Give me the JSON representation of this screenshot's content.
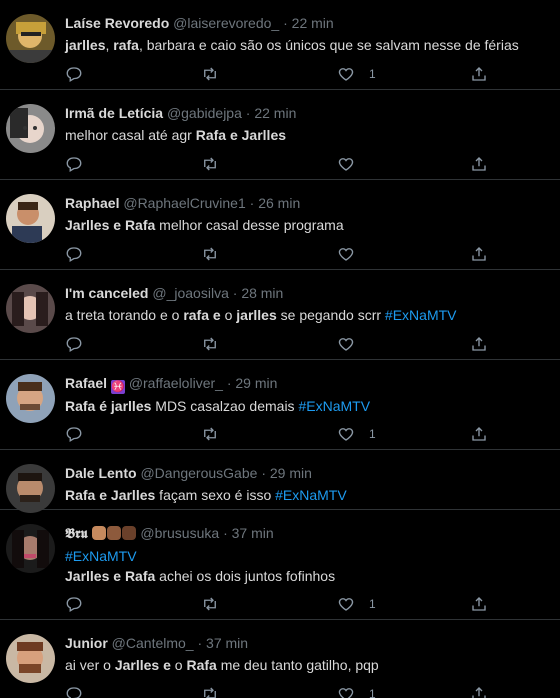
{
  "tweets": [
    {
      "name": "Laíse Revoredo",
      "handle": "@laiserevoredo_",
      "time": "22 min",
      "segments": [
        {
          "t": "b",
          "v": "jarlles"
        },
        {
          "t": "n",
          "v": ", "
        },
        {
          "t": "b",
          "v": "rafa"
        },
        {
          "t": "n",
          "v": ", barbara e caio são os únicos que se salvam nesse de férias"
        }
      ],
      "likes": "1"
    },
    {
      "name": "Irmã de Letícia",
      "handle": "@gabidejpa",
      "time": "22 min",
      "segments": [
        {
          "t": "n",
          "v": "melhor casal até agr "
        },
        {
          "t": "b",
          "v": "Rafa e Jarlles"
        }
      ],
      "likes": ""
    },
    {
      "name": "Raphael",
      "handle": "@RaphaelCruvine1",
      "time": "26 min",
      "segments": [
        {
          "t": "b",
          "v": "Jarlles e Rafa"
        },
        {
          "t": "n",
          "v": " melhor casal desse programa"
        }
      ],
      "likes": ""
    },
    {
      "name": "I'm canceled",
      "handle": "@_joaosilva",
      "time": "28 min",
      "segments": [
        {
          "t": "n",
          "v": "a treta torando e o "
        },
        {
          "t": "b",
          "v": "rafa"
        },
        {
          "t": "n",
          "v": " "
        },
        {
          "t": "b",
          "v": "e"
        },
        {
          "t": "n",
          "v": " o "
        },
        {
          "t": "b",
          "v": "jarlles"
        },
        {
          "t": "n",
          "v": " se pegando scrr "
        },
        {
          "t": "h",
          "v": "#ExNaMTV"
        }
      ],
      "likes": ""
    },
    {
      "name": "Rafael",
      "name_emoji": "♓",
      "handle": "@raffaeloliver_",
      "time": "29 min",
      "segments": [
        {
          "t": "b",
          "v": "Rafa é jarlles"
        },
        {
          "t": "n",
          "v": " MDS casalzao demais "
        },
        {
          "t": "h",
          "v": "#ExNaMTV"
        }
      ],
      "likes": "1"
    },
    {
      "name": "Dale Lento",
      "handle": "@DangerousGabe",
      "time": "29 min",
      "segments": [
        {
          "t": "b",
          "v": "Rafa e Jarlles"
        },
        {
          "t": "n",
          "v": " façam sexo é isso "
        },
        {
          "t": "h",
          "v": "#ExNaMTV"
        }
      ],
      "likes": ""
    },
    {
      "name": "𝕭𝖗𝖚",
      "handle": "@brususuka",
      "time": "37 min",
      "segments": [
        {
          "t": "h",
          "v": "#ExNaMTV"
        },
        {
          "t": "br",
          "v": ""
        },
        {
          "t": "b",
          "v": "Jarlles e Rafa"
        },
        {
          "t": "n",
          "v": " achei os dois juntos fofinhos"
        }
      ],
      "likes": "1"
    },
    {
      "name": "Junior",
      "handle": "@Cantelmo_",
      "time": "37 min",
      "segments": [
        {
          "t": "n",
          "v": "ai ver o "
        },
        {
          "t": "b",
          "v": "Jarlles e"
        },
        {
          "t": "n",
          "v": " o "
        },
        {
          "t": "b",
          "v": "Rafa"
        },
        {
          "t": "n",
          "v": " me deu tanto gatilho, pqp"
        }
      ],
      "likes": "1"
    }
  ],
  "header_separator": "·",
  "colors": {
    "background": "#000000",
    "text": "#d9d9d9",
    "muted": "#6e767d",
    "hashtag": "#1d9bf0",
    "divider": "#2f3336"
  },
  "icons": [
    "reply-icon",
    "retweet-icon",
    "like-icon",
    "share-icon"
  ]
}
